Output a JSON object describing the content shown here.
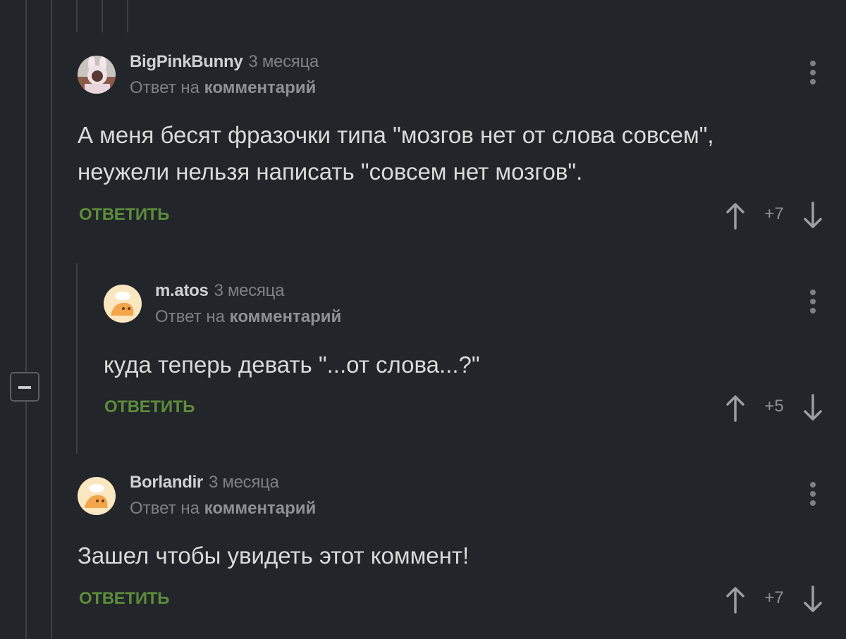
{
  "comments": [
    {
      "author": "BigPinkBunny",
      "time": "3 месяца",
      "reply_prefix": "Ответ на",
      "reply_link": "комментарий",
      "text_lines": [
        "А меня бесят фразочки типа \"мозгов нет от слова совсем\",",
        "неужели нельзя написать \"совсем нет мозгов\"."
      ],
      "reply_label": "ОТВЕТИТЬ",
      "rating": "+7"
    },
    {
      "author": "m.atos",
      "time": "3 месяца",
      "reply_prefix": "Ответ на",
      "reply_link": "комментарий",
      "text_lines": [
        "куда теперь девать \"...от слова...?\""
      ],
      "reply_label": "ОТВЕТИТЬ",
      "rating": "+5"
    },
    {
      "author": "Borlandir",
      "time": "3 месяца",
      "reply_prefix": "Ответ на",
      "reply_link": "комментарий",
      "text_lines": [
        "Зашел чтобы увидеть этот коммент!"
      ],
      "reply_label": "ОТВЕТИТЬ",
      "rating": "+7"
    }
  ],
  "colors": {
    "background": "#222529",
    "reply_green": "#5d8c3a",
    "thread_line": "#3c4046"
  },
  "icons": {
    "collapse": "minus-icon",
    "menu": "more-vertical-icon",
    "upvote": "arrow-up-icon",
    "downvote": "arrow-down-icon"
  }
}
